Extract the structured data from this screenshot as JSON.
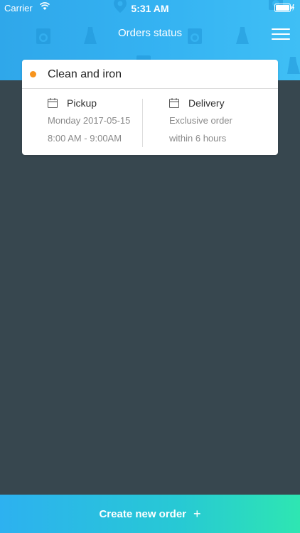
{
  "status_bar": {
    "carrier": "Carrier",
    "time": "5:31 AM",
    "icons": [
      "wifi-icon",
      "battery-icon",
      "charging-icon"
    ]
  },
  "header": {
    "title": "Orders status",
    "menu_icon": "hamburger-menu-icon",
    "background_pattern": [
      "washing-machine-icon",
      "dress-icon",
      "map-pin-icon"
    ]
  },
  "order": {
    "status_color": "#f7941d",
    "title": "Clean and iron",
    "pickup": {
      "icon": "calendar-icon",
      "label": "Pickup",
      "date": "Monday 2017-05-15",
      "time": "8:00 AM - 9:00AM"
    },
    "delivery": {
      "icon": "calendar-icon",
      "label": "Delivery",
      "type": "Exclusive order",
      "time": "within 6 hours"
    }
  },
  "bottom_button": {
    "label": "Create new order",
    "icon": "plus-icon",
    "symbol": "+"
  },
  "colors": {
    "header": "#35b3f2",
    "background": "#37474f",
    "button_start": "#2db1f0",
    "button_end": "#2ee6b2"
  }
}
